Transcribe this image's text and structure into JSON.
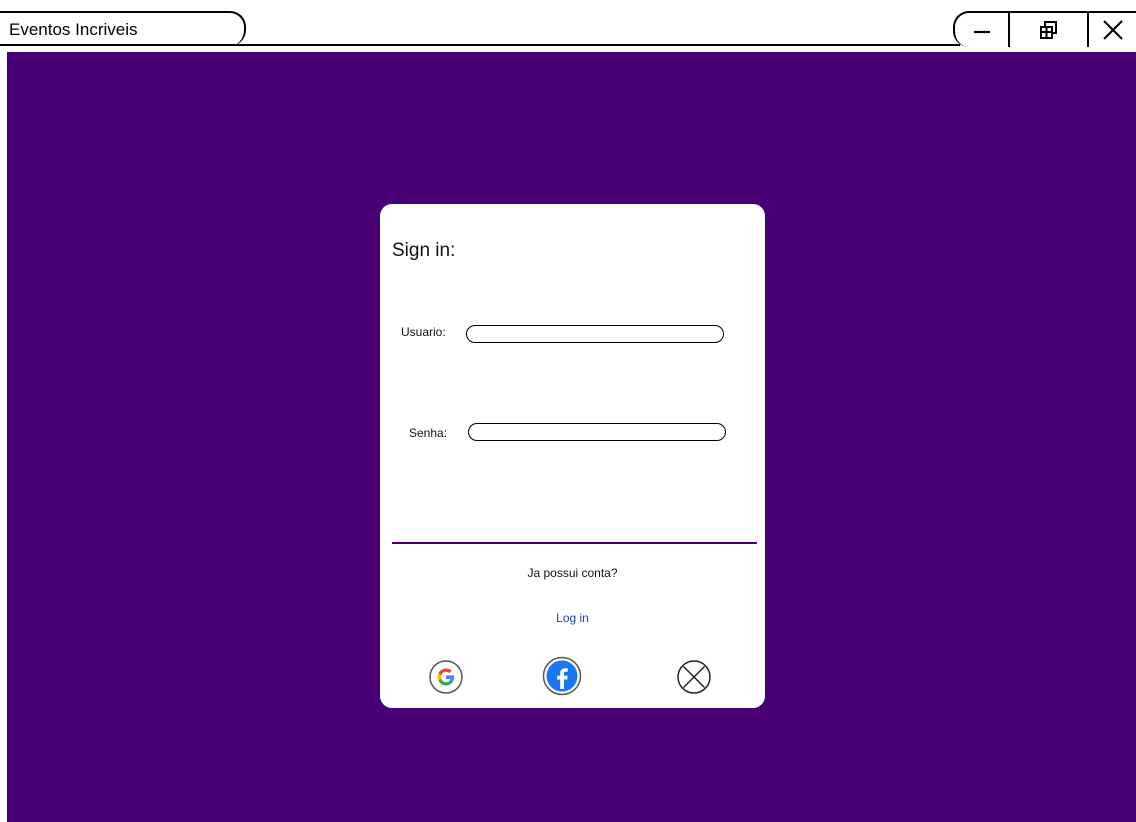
{
  "window": {
    "title": "Eventos Incriveis",
    "controls": {
      "minimize_icon": "minimize-icon",
      "restore_icon": "restore-icon",
      "close_icon": "close-icon"
    }
  },
  "colors": {
    "background": "#490074",
    "card": "#ffffff",
    "link": "#1a3fb8",
    "divider": "#490074"
  },
  "signin": {
    "title": "Sign in:",
    "usuario_label": "Usuario:",
    "usuario_value": "",
    "senha_label": "Senha:",
    "senha_value": "",
    "account_question": "Ja possui conta?",
    "login_link": "Log in",
    "social": [
      "google-icon",
      "facebook-icon",
      "cancel-circle-icon"
    ]
  }
}
